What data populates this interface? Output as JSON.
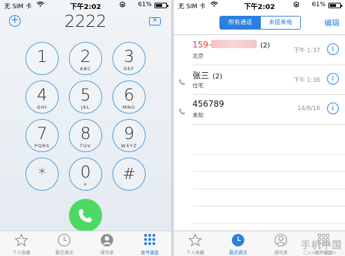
{
  "left": {
    "status": {
      "carrier": "无 SIM 卡",
      "time": "下午2:02",
      "battery": "61%"
    },
    "dialed_number": "2222",
    "add_symbol": "+",
    "delete_symbol": "✕",
    "keys": [
      {
        "digit": "1",
        "letters": ""
      },
      {
        "digit": "2",
        "letters": "ABC"
      },
      {
        "digit": "3",
        "letters": "DEF"
      },
      {
        "digit": "4",
        "letters": "GHI"
      },
      {
        "digit": "5",
        "letters": "JKL"
      },
      {
        "digit": "6",
        "letters": "MNO"
      },
      {
        "digit": "7",
        "letters": "PQRS"
      },
      {
        "digit": "8",
        "letters": "TUV"
      },
      {
        "digit": "9",
        "letters": "WXYZ"
      },
      {
        "digit": "*",
        "letters": ""
      },
      {
        "digit": "0",
        "letters": "+"
      },
      {
        "digit": "#",
        "letters": ""
      }
    ],
    "tabs": [
      {
        "label": "个人收藏",
        "icon": "star-icon"
      },
      {
        "label": "最近通话",
        "icon": "clock-icon"
      },
      {
        "label": "通讯录",
        "icon": "contacts-icon"
      },
      {
        "label": "拨号键盘",
        "icon": "keypad-icon"
      }
    ],
    "active_tab": 3
  },
  "right": {
    "status": {
      "carrier": "无 SIM 卡",
      "time": "下午2:02",
      "battery": "61%"
    },
    "segments": {
      "all": "所有通话",
      "missed": "未接来电"
    },
    "edit": "编辑",
    "calls": [
      {
        "name": "159-",
        "count": "(2)",
        "label": "北京",
        "time": "下午 1:37",
        "missed": true
      },
      {
        "name": "张三",
        "count": "(2)",
        "label": "住宅",
        "time": "下午 1:36",
        "missed": false
      },
      {
        "name": "456789",
        "count": "",
        "label": "未知",
        "time": "14/6/16",
        "missed": false
      }
    ],
    "tabs": [
      {
        "label": "个人收藏",
        "icon": "star-icon"
      },
      {
        "label": "最近通话",
        "icon": "clock-icon"
      },
      {
        "label": "通讯录",
        "icon": "contacts-icon"
      },
      {
        "label": "拨号键盘",
        "icon": "keypad-icon"
      }
    ],
    "active_tab": 1,
    "watermark": "手机中国",
    "watermark_sub": "CNMO.COM"
  },
  "colors": {
    "accent": "#2b7fe0",
    "call_green": "#4cd964",
    "missed_red": "#e53935"
  }
}
